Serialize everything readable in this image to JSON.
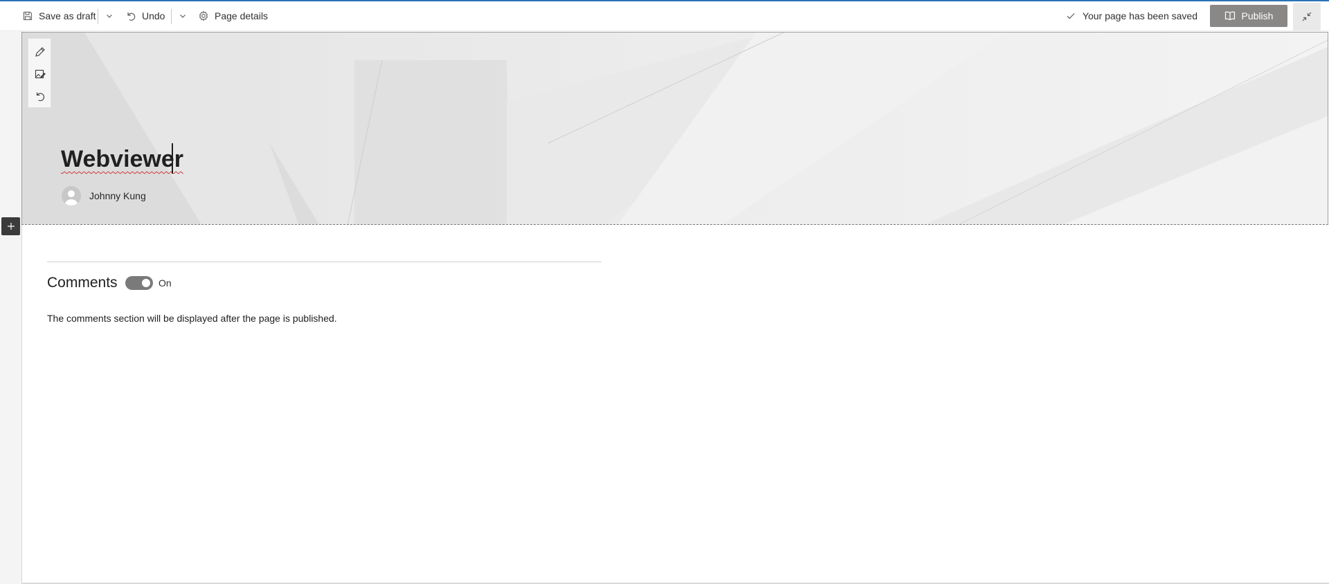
{
  "toolbar": {
    "save_draft_label": "Save as draft",
    "undo_label": "Undo",
    "page_details_label": "Page details",
    "saved_status": "Your page has been saved",
    "publish_label": "Publish"
  },
  "hero": {
    "title": "Webviewer",
    "author": "Johnny Kung"
  },
  "comments": {
    "heading": "Comments",
    "toggle_state": "On",
    "toggle_on": true,
    "note": "The comments section will be displayed after the page is published."
  },
  "colors": {
    "accent_line": "#2a73b8",
    "publish_button": "#8a8886",
    "toggle_track": "#7a7a7a",
    "spellcheck": "#d13438"
  },
  "icons": [
    "save-icon",
    "chevron-down-icon",
    "undo-icon",
    "gear-icon",
    "checkmark-icon",
    "publish-icon",
    "collapse-icon",
    "edit-pencil-icon",
    "edit-image-icon",
    "reset-icon",
    "plus-icon",
    "person-icon"
  ]
}
